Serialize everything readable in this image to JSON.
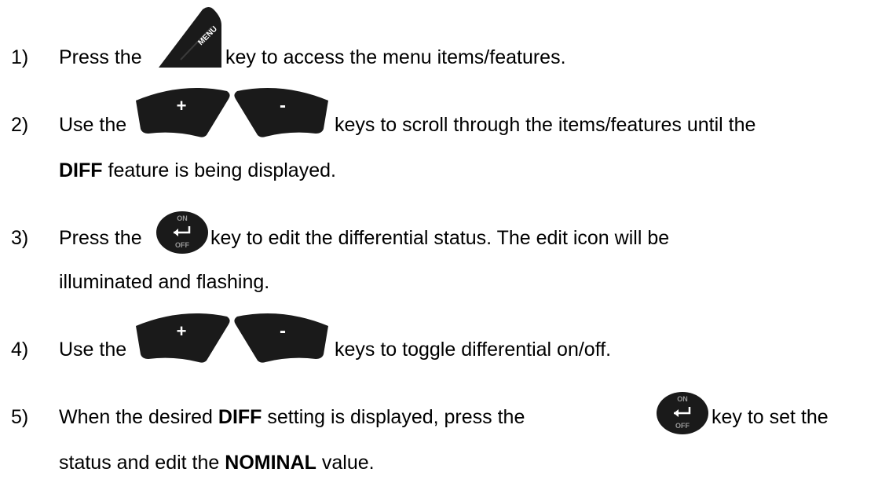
{
  "steps": [
    {
      "number": "1)",
      "pre": "Press the",
      "key1": "MENU",
      "post": "key to access the menu items/features."
    },
    {
      "number": "2)",
      "pre": "Use the",
      "plus": "+",
      "minus": "-",
      "post": "keys to scroll through the items/features until the",
      "bold": "DIFF",
      "post2": "feature is being displayed."
    },
    {
      "number": "3)",
      "pre": "Press the",
      "on": "ON",
      "off": "OFF",
      "post": "key to edit the differential status.  The edit icon will be",
      "post2": "illuminated and flashing."
    },
    {
      "number": "4)",
      "pre": "Use the",
      "plus": "+",
      "minus": "-",
      "post": "keys to toggle differential on/off."
    },
    {
      "number": "5)",
      "pre": "When the desired",
      "bold": "DIFF",
      "mid": "setting is displayed, press the",
      "on": "ON",
      "off": "OFF",
      "post": "key to set the",
      "post2a": "status and edit the",
      "bold2": "NOMINAL",
      "post2b": "value."
    }
  ],
  "colors": {
    "key_body": "#1a1a1a",
    "key_label": "#ffffff",
    "key_label_dim": "#9a9a9a",
    "text": "#000000"
  },
  "icons": [
    "menu-key-icon",
    "plus-key-icon",
    "minus-key-icon",
    "enter-key-icon"
  ]
}
